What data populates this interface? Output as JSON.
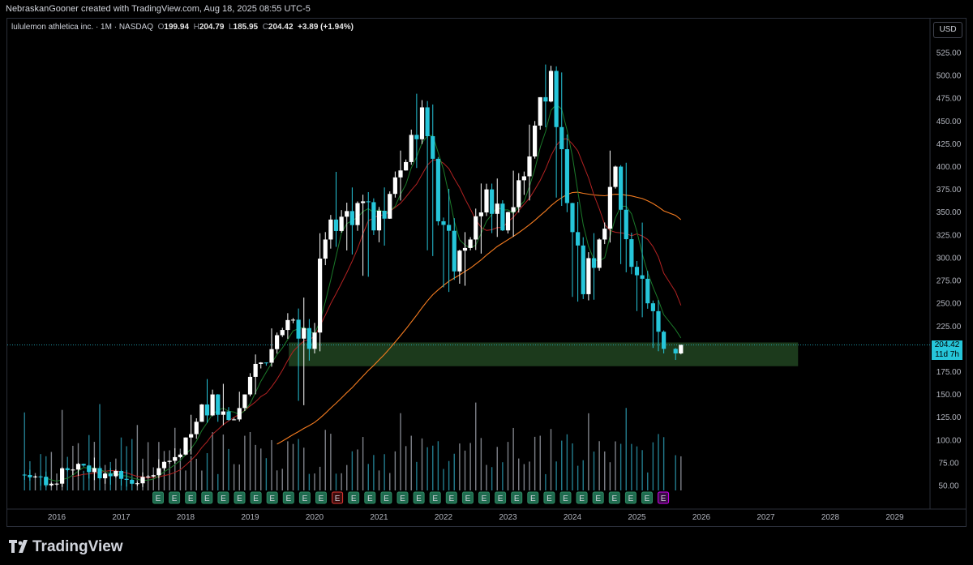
{
  "header": {
    "attribution": "NebraskanGooner created with TradingView.com, Aug 18, 2025 08:55 UTC-5"
  },
  "legend": {
    "symbol": "lululemon athletica inc. · 1M · NASDAQ",
    "open_label": "O",
    "open": "199.94",
    "high_label": "H",
    "high": "204.79",
    "low_label": "L",
    "low": "185.95",
    "close_label": "C",
    "close": "204.42",
    "change": "+3.89 (+1.94%)"
  },
  "currency_button": "USD",
  "last_price_tag": {
    "price": "204.42",
    "countdown": "11d 7h"
  },
  "footer": {
    "brand": "TradingView"
  },
  "colors": {
    "up": "#ffffff",
    "down": "#26c6da",
    "ma_fast": "#1b7a2a",
    "ma_mid": "#b22222",
    "ma_slow": "#f57c20",
    "zone": "#1e3d1e",
    "earnings_badge": "#1f6b4f",
    "earnings_badge_alert": "#e53935",
    "earnings_badge_upcoming": "#d500f9"
  },
  "chart_data": {
    "type": "candlestick",
    "interval": "1M",
    "y_ticks": [
      50,
      75,
      100,
      125,
      150,
      175,
      200,
      225,
      250,
      275,
      300,
      325,
      350,
      375,
      400,
      425,
      450,
      475,
      500,
      525
    ],
    "x_ticks": [
      "2016",
      "2017",
      "2018",
      "2019",
      "2020",
      "2021",
      "2022",
      "2023",
      "2024",
      "2025",
      "2026",
      "2027",
      "2028",
      "2029"
    ],
    "ylim": [
      40,
      540
    ],
    "support_zone": {
      "low": 181,
      "high": 207,
      "from": "2019.6",
      "to": "2027.5"
    },
    "last_price": 204.42,
    "earnings_markers": [
      "E",
      "E",
      "E",
      "E",
      "E",
      "E",
      "E",
      "E",
      "E",
      "E",
      "E",
      "E",
      "E",
      "E",
      "E",
      "E",
      "E",
      "E",
      "E",
      "E",
      "E",
      "E",
      "E",
      "E",
      "E",
      "E",
      "E",
      "E",
      "E",
      "E",
      "E",
      "E"
    ],
    "closes_quarterly": [
      {
        "t": "2015.5",
        "o": 62,
        "h": 68,
        "l": 55,
        "c": 60
      },
      {
        "t": "2015.75",
        "o": 60,
        "h": 66,
        "l": 48,
        "c": 52
      },
      {
        "t": "2016.0",
        "o": 52,
        "h": 70,
        "l": 48,
        "c": 67
      },
      {
        "t": "2016.25",
        "o": 67,
        "h": 75,
        "l": 60,
        "c": 72
      },
      {
        "t": "2016.5",
        "o": 72,
        "h": 82,
        "l": 55,
        "c": 58
      },
      {
        "t": "2016.75",
        "o": 58,
        "h": 70,
        "l": 50,
        "c": 66
      },
      {
        "t": "2017.0",
        "o": 66,
        "h": 68,
        "l": 48,
        "c": 52
      },
      {
        "t": "2017.25",
        "o": 52,
        "h": 65,
        "l": 48,
        "c": 60
      },
      {
        "t": "2017.5",
        "o": 60,
        "h": 80,
        "l": 58,
        "c": 76
      },
      {
        "t": "2017.75",
        "o": 76,
        "h": 92,
        "l": 74,
        "c": 84
      },
      {
        "t": "2018.0",
        "o": 84,
        "h": 130,
        "l": 82,
        "c": 120
      },
      {
        "t": "2018.25",
        "o": 120,
        "h": 170,
        "l": 118,
        "c": 150
      },
      {
        "t": "2018.5",
        "o": 150,
        "h": 165,
        "l": 115,
        "c": 122
      },
      {
        "t": "2018.75",
        "o": 122,
        "h": 155,
        "l": 120,
        "c": 150
      },
      {
        "t": "2019.0",
        "o": 150,
        "h": 195,
        "l": 148,
        "c": 185
      },
      {
        "t": "2019.25",
        "o": 185,
        "h": 225,
        "l": 180,
        "c": 215
      },
      {
        "t": "2019.5",
        "o": 215,
        "h": 240,
        "l": 210,
        "c": 232
      },
      {
        "t": "2019.75",
        "o": 232,
        "h": 260,
        "l": 130,
        "c": 200
      },
      {
        "t": "2020.0",
        "o": 200,
        "h": 330,
        "l": 195,
        "c": 320
      },
      {
        "t": "2020.25",
        "o": 320,
        "h": 400,
        "l": 310,
        "c": 345
      },
      {
        "t": "2020.5",
        "o": 345,
        "h": 380,
        "l": 300,
        "c": 360
      },
      {
        "t": "2020.75",
        "o": 360,
        "h": 372,
        "l": 270,
        "c": 330
      },
      {
        "t": "2021.0",
        "o": 330,
        "h": 380,
        "l": 310,
        "c": 370
      },
      {
        "t": "2021.25",
        "o": 370,
        "h": 420,
        "l": 360,
        "c": 405
      },
      {
        "t": "2021.5",
        "o": 405,
        "h": 485,
        "l": 395,
        "c": 465
      },
      {
        "t": "2021.75",
        "o": 465,
        "h": 472,
        "l": 290,
        "c": 340
      },
      {
        "t": "2022.0",
        "o": 340,
        "h": 380,
        "l": 255,
        "c": 285
      },
      {
        "t": "2022.25",
        "o": 285,
        "h": 330,
        "l": 265,
        "c": 320
      },
      {
        "t": "2022.5",
        "o": 320,
        "h": 385,
        "l": 300,
        "c": 375
      },
      {
        "t": "2022.75",
        "o": 375,
        "h": 390,
        "l": 320,
        "c": 330
      },
      {
        "t": "2023.0",
        "o": 330,
        "h": 400,
        "l": 320,
        "c": 385
      },
      {
        "t": "2023.25",
        "o": 385,
        "h": 450,
        "l": 360,
        "c": 445
      },
      {
        "t": "2023.5",
        "o": 445,
        "h": 516,
        "l": 440,
        "c": 505
      },
      {
        "t": "2023.75",
        "o": 505,
        "h": 510,
        "l": 350,
        "c": 360
      },
      {
        "t": "2024.0",
        "o": 360,
        "h": 365,
        "l": 245,
        "c": 260
      },
      {
        "t": "2024.25",
        "o": 260,
        "h": 330,
        "l": 250,
        "c": 320
      },
      {
        "t": "2024.5",
        "o": 320,
        "h": 422,
        "l": 315,
        "c": 400
      },
      {
        "t": "2024.75",
        "o": 400,
        "h": 410,
        "l": 280,
        "c": 290
      },
      {
        "t": "2025.0",
        "o": 290,
        "h": 345,
        "l": 230,
        "c": 250
      },
      {
        "t": "2025.25",
        "o": 250,
        "h": 255,
        "l": 195,
        "c": 200
      },
      {
        "t": "2025.5",
        "o": 200,
        "h": 205,
        "l": 186,
        "c": 204.42
      }
    ]
  }
}
